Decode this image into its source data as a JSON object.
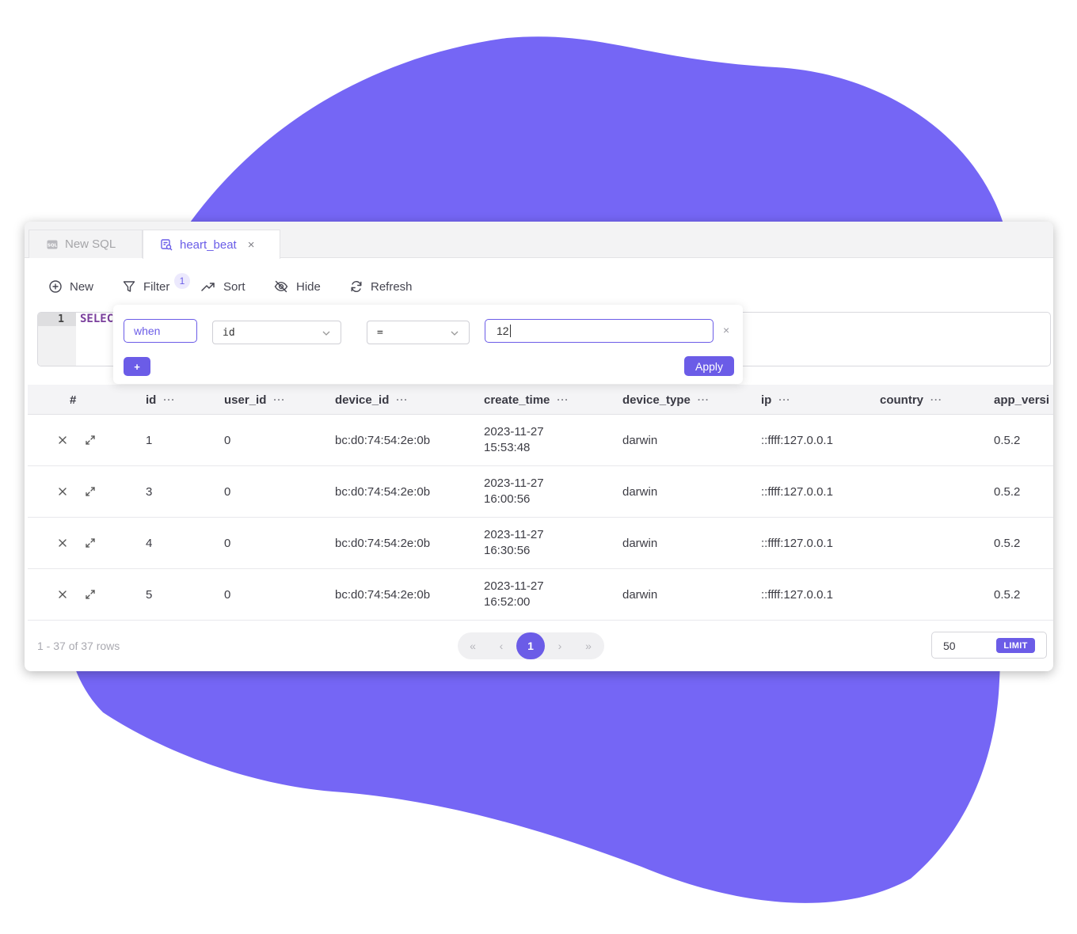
{
  "colors": {
    "accent": "#6b5ce7",
    "blob": "#7566f5"
  },
  "tabs": [
    {
      "label": "New SQL",
      "icon": "sql-file-icon"
    },
    {
      "label": "heart_beat",
      "icon": "table-search-icon",
      "close": "×"
    }
  ],
  "toolbar": {
    "new_label": "New",
    "filter_label": "Filter",
    "filter_count": "1",
    "sort_label": "Sort",
    "hide_label": "Hide",
    "refresh_label": "Refresh"
  },
  "editor": {
    "line_number": "1",
    "code": "SELEC"
  },
  "filter": {
    "when_label": "when",
    "field_value": "id",
    "operator_value": "=",
    "input_value": "12",
    "close": "×",
    "add_label": "+",
    "apply_label": "Apply"
  },
  "table": {
    "columns": [
      "#",
      "id",
      "user_id",
      "device_id",
      "create_time",
      "device_type",
      "ip",
      "country",
      "app_versi"
    ],
    "rows": [
      {
        "id": "1",
        "user_id": "0",
        "device_id": "bc:d0:74:54:2e:0b",
        "date": "2023-11-27",
        "time": "15:53:48",
        "device_type": "darwin",
        "ip": "::ffff:127.0.0.1",
        "country": "",
        "app_version": "0.5.2"
      },
      {
        "id": "3",
        "user_id": "0",
        "device_id": "bc:d0:74:54:2e:0b",
        "date": "2023-11-27",
        "time": "16:00:56",
        "device_type": "darwin",
        "ip": "::ffff:127.0.0.1",
        "country": "",
        "app_version": "0.5.2"
      },
      {
        "id": "4",
        "user_id": "0",
        "device_id": "bc:d0:74:54:2e:0b",
        "date": "2023-11-27",
        "time": "16:30:56",
        "device_type": "darwin",
        "ip": "::ffff:127.0.0.1",
        "country": "",
        "app_version": "0.5.2"
      },
      {
        "id": "5",
        "user_id": "0",
        "device_id": "bc:d0:74:54:2e:0b",
        "date": "2023-11-27",
        "time": "16:52:00",
        "device_type": "darwin",
        "ip": "::ffff:127.0.0.1",
        "country": "",
        "app_version": "0.5.2"
      }
    ]
  },
  "footer": {
    "row_info": "1 - 37 of 37 rows",
    "pager": {
      "first": "«",
      "prev": "‹",
      "current": "1",
      "next": "›",
      "last": "»"
    },
    "limit_value": "50",
    "limit_label": "LIMIT"
  }
}
